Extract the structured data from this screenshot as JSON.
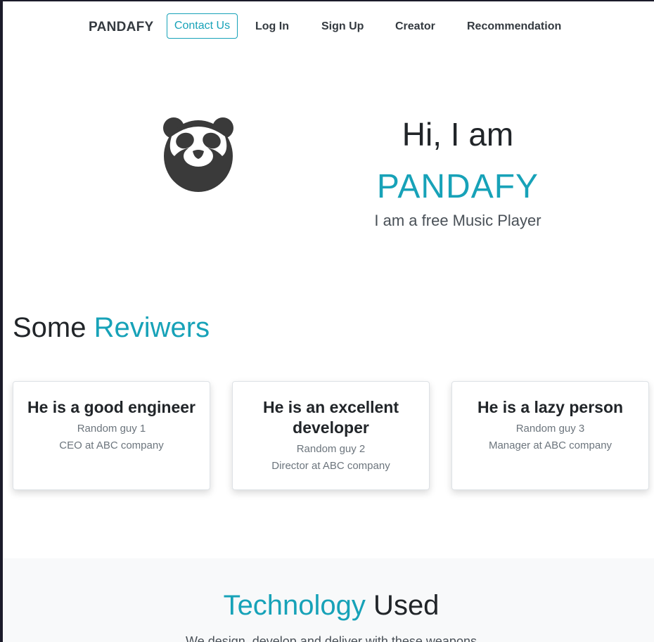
{
  "nav": {
    "brand": "PANDAFY",
    "contact": "Contact Us",
    "links": [
      "Log In",
      "Sign Up",
      "Creator",
      "Recommendation"
    ]
  },
  "hero": {
    "greeting": "Hi, I am",
    "name": "PANDAFY",
    "subtitle": "I am a free Music Player",
    "logo_icon": "panda-logo-icon"
  },
  "reviewers": {
    "title_plain": "Some ",
    "title_accent": "Reviwers",
    "cards": [
      {
        "quote": "He is a good engineer",
        "name": "Random guy 1",
        "role": "CEO at ABC company"
      },
      {
        "quote": "He is an excellent developer",
        "name": "Random guy 2",
        "role": "Director at ABC company"
      },
      {
        "quote": "He is a lazy person",
        "name": "Random guy 3",
        "role": "Manager at ABC company"
      }
    ]
  },
  "technology": {
    "title_accent": "Technology",
    "title_plain": " Used",
    "subtitle": "We design, develop and deliver with these weapons"
  },
  "colors": {
    "accent": "#17a2b8",
    "text_dark": "#212529",
    "panda": "#3a3a3a"
  }
}
